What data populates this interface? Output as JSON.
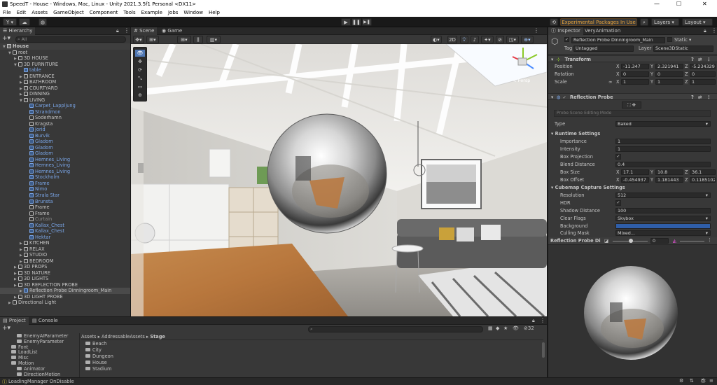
{
  "window": {
    "title": "SpeedT - House - Windows, Mac, Linux - Unity 2021.3.5f1 Personal <DX11>",
    "minimize": "—",
    "maximize": "☐",
    "close": "✕"
  },
  "menu": [
    "File",
    "Edit",
    "Assets",
    "GameObject",
    "Component",
    "Tools",
    "Example",
    "Jobs",
    "Window",
    "Help"
  ],
  "toolbar": {
    "account": "Y ▾",
    "play": "▶",
    "pause": "❚❚",
    "step": "▶❚",
    "experimental": "Experimental Packages In Use ▾",
    "layers": "Layers",
    "layout": "Layout"
  },
  "hierarchy": {
    "tab": "Hierarchy",
    "search_placeholder": "All",
    "rows": [
      {
        "label": "House",
        "indent": 0,
        "style": "scene"
      },
      {
        "label": "root",
        "indent": 1,
        "style": ""
      },
      {
        "label": "3D HOUSE",
        "indent": 2,
        "style": ""
      },
      {
        "label": "3D FURNITURE",
        "indent": 2,
        "style": ""
      },
      {
        "label": "table",
        "indent": 3,
        "style": "blue"
      },
      {
        "label": "ENTRANCE",
        "indent": 3,
        "style": ""
      },
      {
        "label": "BATHROOM",
        "indent": 3,
        "style": ""
      },
      {
        "label": "COURTYARD",
        "indent": 3,
        "style": ""
      },
      {
        "label": "DINNING",
        "indent": 3,
        "style": ""
      },
      {
        "label": "LIVING",
        "indent": 3,
        "style": ""
      },
      {
        "label": "Carpet_Lappljung",
        "indent": 4,
        "style": "blue"
      },
      {
        "label": "Strandmon",
        "indent": 4,
        "style": "blue"
      },
      {
        "label": "Soderhamn",
        "indent": 4,
        "style": ""
      },
      {
        "label": "Kragsta",
        "indent": 4,
        "style": ""
      },
      {
        "label": "Jorid",
        "indent": 4,
        "style": "blue"
      },
      {
        "label": "Burvik",
        "indent": 4,
        "style": "blue"
      },
      {
        "label": "Gladom",
        "indent": 4,
        "style": "blue"
      },
      {
        "label": "Gladom",
        "indent": 4,
        "style": "blue"
      },
      {
        "label": "Gladom",
        "indent": 4,
        "style": "blue"
      },
      {
        "label": "Hemnes_Living",
        "indent": 4,
        "style": "blue"
      },
      {
        "label": "Hemnes_Living",
        "indent": 4,
        "style": "blue"
      },
      {
        "label": "Hemnes_Living",
        "indent": 4,
        "style": "blue"
      },
      {
        "label": "Stockholm",
        "indent": 4,
        "style": "blue"
      },
      {
        "label": "Frame",
        "indent": 4,
        "style": "blue"
      },
      {
        "label": "Nimo",
        "indent": 4,
        "style": "blue"
      },
      {
        "label": "Strala Star",
        "indent": 4,
        "style": "blue"
      },
      {
        "label": "Brunsta",
        "indent": 4,
        "style": "blue"
      },
      {
        "label": "Frame",
        "indent": 4,
        "style": ""
      },
      {
        "label": "Frame",
        "indent": 4,
        "style": ""
      },
      {
        "label": "Curtain",
        "indent": 4,
        "style": "dim"
      },
      {
        "label": "Kallax_Chest",
        "indent": 4,
        "style": "blue"
      },
      {
        "label": "Kallax_Chest",
        "indent": 4,
        "style": "blue"
      },
      {
        "label": "Hektar",
        "indent": 4,
        "style": "blue"
      },
      {
        "label": "KITCHEN",
        "indent": 3,
        "style": ""
      },
      {
        "label": "RELAX",
        "indent": 3,
        "style": ""
      },
      {
        "label": "STUDIO",
        "indent": 3,
        "style": ""
      },
      {
        "label": "BEDROOM",
        "indent": 3,
        "style": ""
      },
      {
        "label": "3D PROPS",
        "indent": 2,
        "style": ""
      },
      {
        "label": "3D NATURE",
        "indent": 2,
        "style": ""
      },
      {
        "label": "3D LIGHTS",
        "indent": 2,
        "style": ""
      },
      {
        "label": "3D REFLECTION PROBE",
        "indent": 2,
        "style": ""
      },
      {
        "label": "Reflection Probe Dinningroom_Main",
        "indent": 3,
        "style": "sel"
      },
      {
        "label": "3D LIGHT PROBE",
        "indent": 2,
        "style": ""
      },
      {
        "label": "Directional Light",
        "indent": 1,
        "style": ""
      }
    ]
  },
  "scene": {
    "tabs": [
      {
        "label": "Scene"
      },
      {
        "label": "Game"
      }
    ],
    "mode_2d": "2D",
    "persp_label": "< Persp"
  },
  "inspector": {
    "tabs": [
      {
        "label": "Inspector"
      },
      {
        "label": "VeryAnimation"
      }
    ],
    "object_name": "Reflection Probe Dinningroom_Main",
    "static_label": "Static",
    "tag_label": "Tag",
    "tag_value": "Untagged",
    "layer_label": "Layer",
    "layer_value": "Scene3DStatic",
    "transform": {
      "header": "Transform",
      "rows": [
        {
          "label": "Position",
          "x": "-11.347",
          "y": "2.321941",
          "z": "-5.234329"
        },
        {
          "label": "Rotation",
          "x": "0",
          "y": "0",
          "z": "0"
        },
        {
          "label": "Scale",
          "x": "1",
          "y": "1",
          "z": "1"
        }
      ]
    },
    "probe": {
      "header": "Reflection Probe",
      "editing_mode": "Probe Scene Editing Mode",
      "type_label": "Type",
      "type_value": "Baked",
      "runtime_header": "Runtime Settings",
      "importance_label": "Importance",
      "importance_value": "1",
      "intensity_label": "Intensity",
      "intensity_value": "1",
      "box_projection_label": "Box Projection",
      "blend_label": "Blend Distance",
      "blend_value": "0.4",
      "box_size_label": "Box Size",
      "box_size": {
        "x": "17.1",
        "y": "10.8",
        "z": "36.1"
      },
      "box_offset_label": "Box Offset",
      "box_offset": {
        "x": "-0.454937",
        "y": "1.181443",
        "z": "0.1185102"
      },
      "cubemap_header": "Cubemap Capture Settings",
      "resolution_label": "Resolution",
      "resolution_value": "512",
      "hdr_label": "HDR",
      "shadow_label": "Shadow Distance",
      "shadow_value": "100",
      "clear_label": "Clear Flags",
      "clear_value": "Skybox",
      "background_label": "Background",
      "background_color": "#2f5ea8",
      "culling_label": "Culling Mask",
      "culling_value": "Mixed..."
    }
  },
  "preview": {
    "title": "Reflection Probe Di",
    "value": "0"
  },
  "project": {
    "tabs": [
      {
        "label": "Project"
      },
      {
        "label": "Console"
      }
    ],
    "count": "32",
    "tree": [
      {
        "label": "EnemyAIParameter",
        "indent": 3
      },
      {
        "label": "EnemyParameter",
        "indent": 3
      },
      {
        "label": "Font",
        "indent": 2
      },
      {
        "label": "LoadList",
        "indent": 2
      },
      {
        "label": "Misc",
        "indent": 2
      },
      {
        "label": "Motion",
        "indent": 2
      },
      {
        "label": "Animator",
        "indent": 3
      },
      {
        "label": "DirectionMotion",
        "indent": 3
      }
    ],
    "breadcrumb": [
      "Assets",
      "AddressableAssets",
      "Stage"
    ],
    "folders": [
      "Beach",
      "City",
      "Dungeon",
      "House",
      "Stadium"
    ]
  },
  "status": {
    "message": "LoadingManager OnDisable"
  },
  "colors": {
    "accent": "#7aa6e8",
    "experimental": "#e8a33a"
  }
}
